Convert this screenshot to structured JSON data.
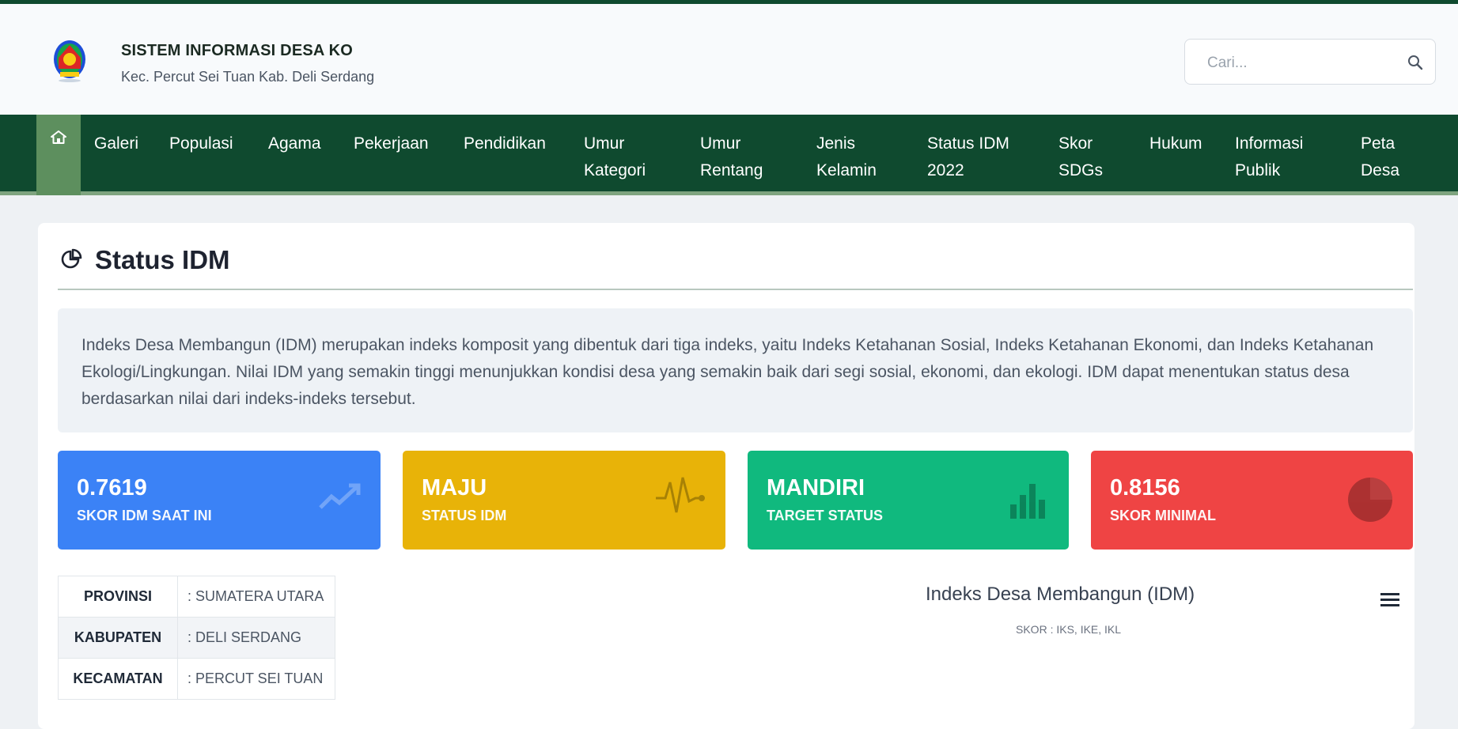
{
  "header": {
    "site_title": "SISTEM INFORMASI DESA KO",
    "site_subtitle": "Kec. Percut Sei Tuan Kab. Deli Serdang",
    "search_placeholder": "Cari..."
  },
  "nav": {
    "home_icon": "home-icon",
    "items": [
      "Galeri",
      "Populasi",
      "Agama",
      "Pekerjaan",
      "Pendidikan",
      "Umur\nKategori",
      "Umur\nRentang",
      "Jenis\nKelamin",
      "Status IDM\n2022",
      "Skor\nSDGs",
      "Hukum",
      "Informasi\nPublik",
      "Peta\nDesa"
    ]
  },
  "page": {
    "title": "Status IDM",
    "intro": "Indeks Desa Membangun (IDM) merupakan indeks komposit yang dibentuk dari tiga indeks, yaitu Indeks Ketahanan Sosial, Indeks Ketahanan Ekonomi, dan Indeks Ketahanan Ekologi/Lingkungan. Nilai IDM yang semakin tinggi menunjukkan kondisi desa yang semakin baik dari segi sosial, ekonomi, dan ekologi. IDM dapat menentukan status desa berdasarkan nilai dari indeks-indeks tersebut."
  },
  "stats": [
    {
      "value": "0.7619",
      "label": "SKOR IDM SAAT INI",
      "color": "#3b82f6",
      "icon": "trend-icon"
    },
    {
      "value": "MAJU",
      "label": "STATUS IDM",
      "color": "#e8b308",
      "icon": "pulse-icon"
    },
    {
      "value": "MANDIRI",
      "label": "TARGET STATUS",
      "color": "#10b97e",
      "icon": "bar-chart-icon"
    },
    {
      "value": "0.8156",
      "label": "SKOR MINIMAL",
      "color": "#ef4444",
      "icon": "pie-chart-icon"
    }
  ],
  "info": [
    {
      "key": "PROVINSI",
      "value": ": SUMATERA UTARA"
    },
    {
      "key": "KABUPATEN",
      "value": ": DELI SERDANG"
    },
    {
      "key": "KECAMATAN",
      "value": ": PERCUT SEI TUAN"
    }
  ],
  "chart": {
    "title": "Indeks Desa Membangun (IDM)",
    "subtitle": "SKOR : IKS, IKE, IKL"
  },
  "colors": {
    "nav_bg": "#0f4a2f",
    "nav_active": "#5d8f5e"
  }
}
